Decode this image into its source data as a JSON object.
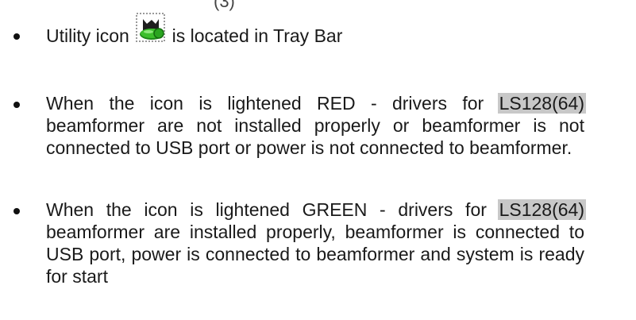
{
  "top_fragment": "(3)",
  "bullets": [
    {
      "before_icon": "Utility icon",
      "icon": "tray-utility-icon",
      "after_icon": "is located in Tray Bar"
    },
    {
      "lead": "When the icon is lightened RED - drivers for ",
      "highlight": "LS128(64)",
      "rest": " beamformer are not installed properly or beamformer is not connected to USB port or power is not connected to beamformer."
    },
    {
      "lead": "When the icon is lightened GREEN - drivers for ",
      "highlight": "LS128(64)",
      "rest": " beamformer are installed properly, beamformer is connected to USB port, power is connected to beamformer and system is ready for start"
    }
  ],
  "colors": {
    "highlight": "#c8c8c8",
    "icon_green": "#3cbf2c",
    "icon_dark": "#1e1e1e"
  }
}
